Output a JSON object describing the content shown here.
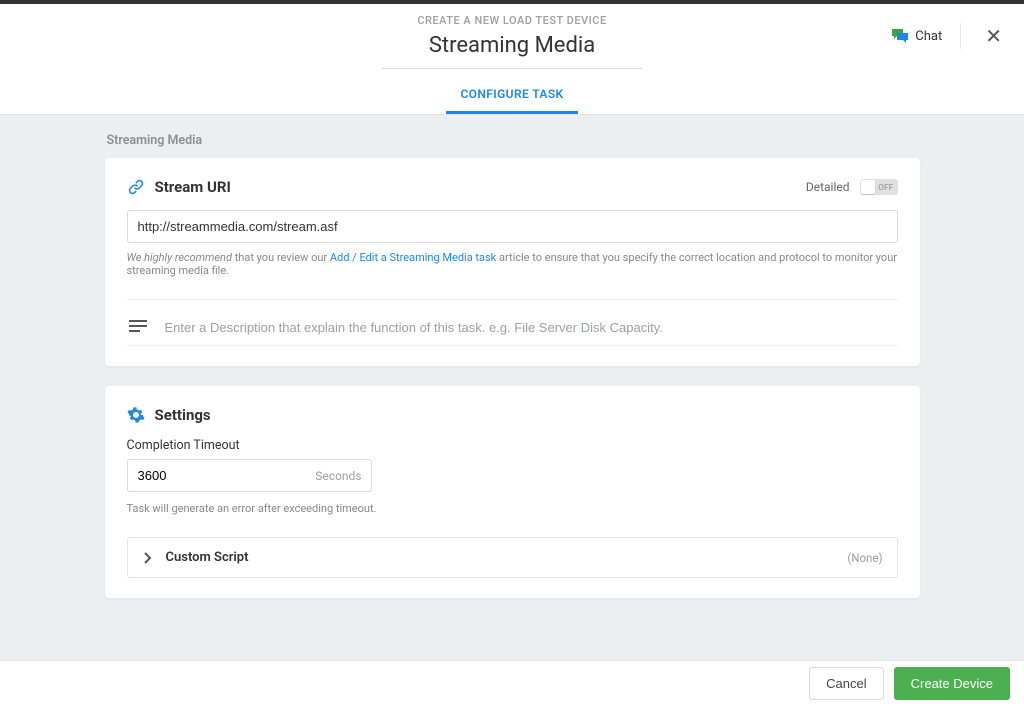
{
  "header": {
    "eyebrow": "CREATE A NEW LOAD TEST DEVICE",
    "title": "Streaming Media",
    "chat_label": "Chat"
  },
  "tabs": {
    "configure": "CONFIGURE TASK"
  },
  "breadcrumb": "Streaming Media",
  "stream": {
    "section_title": "Stream URI",
    "detailed_label": "Detailed",
    "toggle_state": "OFF",
    "uri_value": "http://streammedia.com/stream.asf",
    "hint_prefix": "We highly recommend",
    "hint_mid": " that you review our ",
    "hint_link": "Add / Edit a Streaming Media task",
    "hint_suffix": " article to ensure that you specify the correct location and protocol to monitor your streaming media file.",
    "desc_placeholder": "Enter a Description that explain the function of this task. e.g. File Server Disk Capacity."
  },
  "settings": {
    "section_title": "Settings",
    "timeout_label": "Completion Timeout",
    "timeout_value": "3600",
    "timeout_unit": "Seconds",
    "timeout_hint": "Task will generate an error after exceeding timeout.",
    "custom_script_label": "Custom Script",
    "custom_script_badge": "(None)"
  },
  "footer": {
    "cancel": "Cancel",
    "create": "Create Device"
  }
}
